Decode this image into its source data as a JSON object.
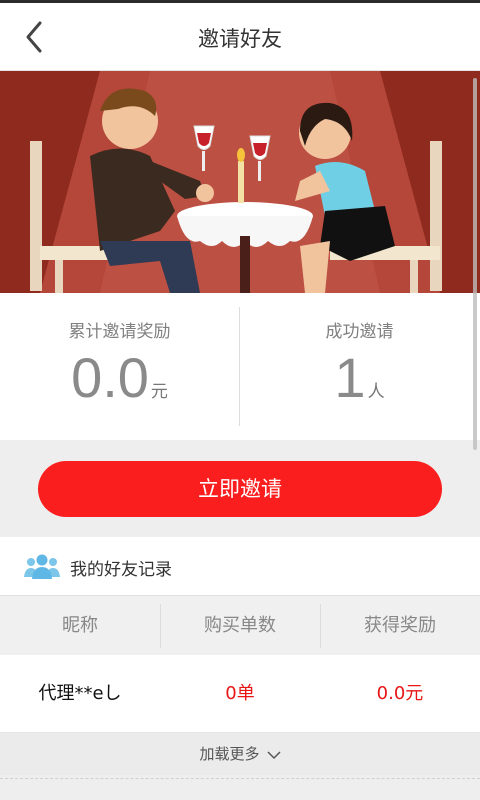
{
  "header": {
    "title": "邀请好友",
    "back_icon": "chevron-left-icon"
  },
  "banner": {
    "description_icon": "couple-dinner-illustration",
    "background_color": "#8f2a1f"
  },
  "stats": {
    "reward": {
      "label": "累计邀请奖励",
      "value": "0.0",
      "unit": "元"
    },
    "invited": {
      "label": "成功邀请",
      "value": "1",
      "unit": "人"
    }
  },
  "actions": {
    "invite_label": "立即邀请",
    "invite_color": "#fb1e1e"
  },
  "records": {
    "title": "我的好友记录",
    "icon": "friends-group-icon",
    "columns": [
      "昵称",
      "购买单数",
      "获得奖励"
    ],
    "rows": [
      {
        "nickname": "代理**eし",
        "orders": "0单",
        "reward": "0.0元"
      }
    ],
    "load_more": "加载更多"
  }
}
